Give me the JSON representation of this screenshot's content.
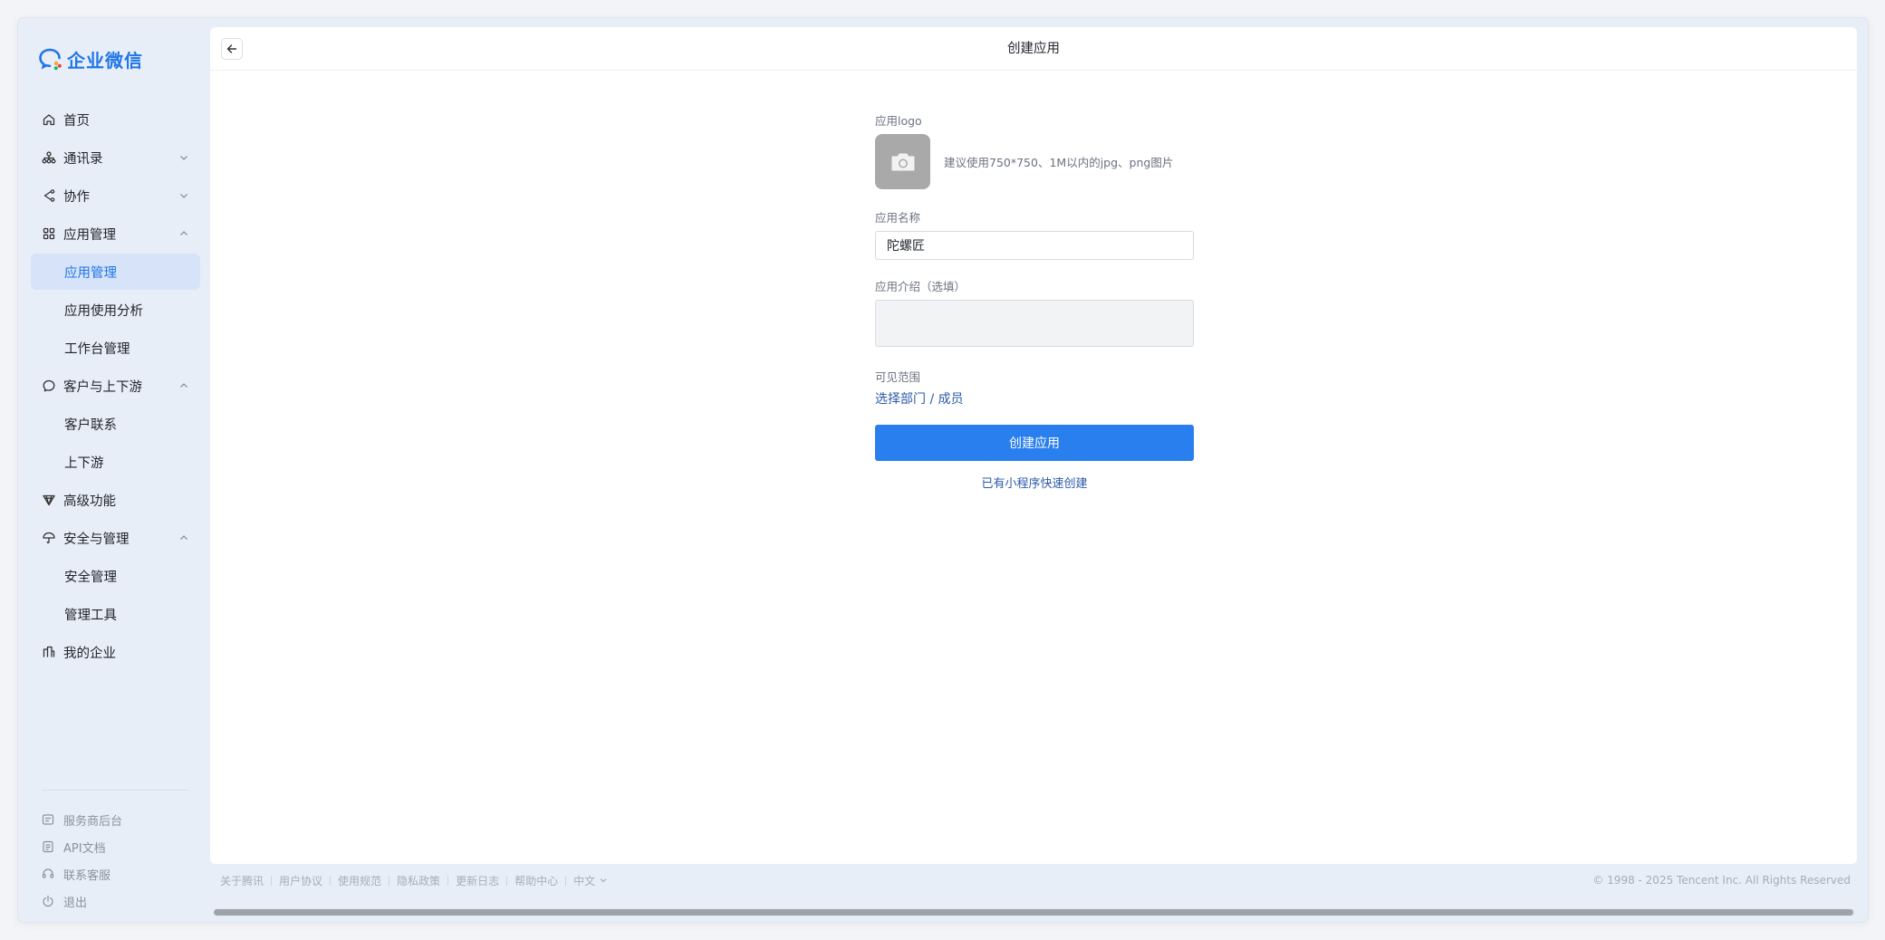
{
  "app": {
    "brand": "企业微信",
    "accent": "#1f76e8"
  },
  "sidebar": {
    "items": [
      {
        "label": "首页",
        "icon": "home-icon"
      },
      {
        "label": "通讯录",
        "icon": "org-chart-icon",
        "expanded": false
      },
      {
        "label": "协作",
        "icon": "share-icon",
        "expanded": false
      },
      {
        "label": "应用管理",
        "icon": "grid-icon",
        "expanded": true
      },
      {
        "label": "应用管理",
        "sub": true,
        "active": true
      },
      {
        "label": "应用使用分析",
        "sub": true
      },
      {
        "label": "工作台管理",
        "sub": true
      },
      {
        "label": "客户与上下游",
        "icon": "chat-bubble-icon",
        "expanded": true
      },
      {
        "label": "客户联系",
        "sub": true
      },
      {
        "label": "上下游",
        "sub": true
      },
      {
        "label": "高级功能",
        "icon": "diamond-icon"
      },
      {
        "label": "安全与管理",
        "icon": "umbrella-icon",
        "expanded": true
      },
      {
        "label": "安全管理",
        "sub": true
      },
      {
        "label": "管理工具",
        "sub": true
      },
      {
        "label": "我的企业",
        "icon": "building-icon"
      }
    ],
    "bottom": [
      {
        "label": "服务商后台",
        "icon": "panel-icon"
      },
      {
        "label": "API文档",
        "icon": "document-icon"
      },
      {
        "label": "联系客服",
        "icon": "headset-icon"
      },
      {
        "label": "退出",
        "icon": "power-icon"
      }
    ]
  },
  "header": {
    "title": "创建应用"
  },
  "form": {
    "logo_label": "应用logo",
    "logo_hint": "建议使用750*750、1M以内的jpg、png图片",
    "name_label": "应用名称",
    "name_value": "陀螺匠",
    "intro_label": "应用介绍（选填）",
    "intro_value": "",
    "scope_label": "可见范围",
    "scope_link": "选择部门 / 成员",
    "submit_label": "创建应用",
    "quick_create": "已有小程序快速创建"
  },
  "footer": {
    "links": [
      "关于腾讯",
      "用户协议",
      "使用规范",
      "隐私政策",
      "更新日志",
      "帮助中心"
    ],
    "language": "中文",
    "copyright": "© 1998 - 2025 Tencent Inc. All Rights Reserved"
  }
}
